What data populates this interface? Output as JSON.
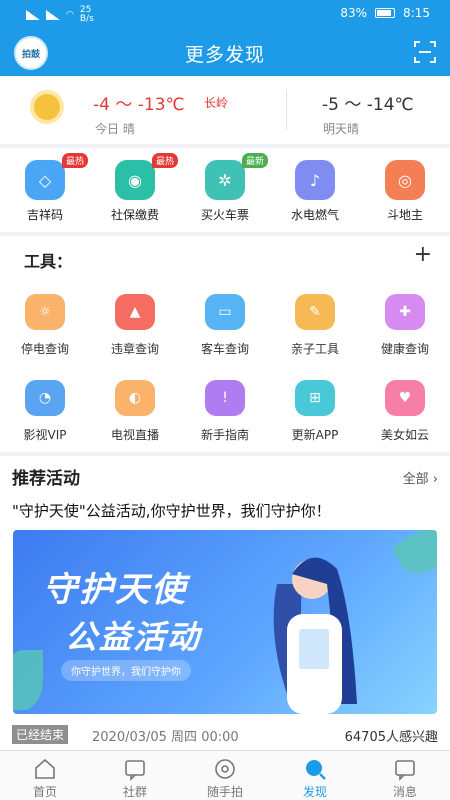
{
  "statusbar": {
    "network": "25\nB/s",
    "battery": "83%",
    "time": "8:15"
  },
  "header": {
    "title": "更多发现",
    "logo": "拍鼓"
  },
  "weather": {
    "today_temp": "-4 ～ -13℃",
    "city": "长岭",
    "today_label": "今日 晴",
    "tomorrow_temp": "-5 ～ -14℃",
    "tomorrow_label": "明天晴"
  },
  "quick_items": [
    {
      "label": "吉祥码",
      "badge": "最热",
      "color": "#4aa6f5"
    },
    {
      "label": "社保缴费",
      "badge": "最热",
      "color": "#2bbfa7"
    },
    {
      "label": "买火车票",
      "badge": "最新",
      "color": "#3fc1b5"
    },
    {
      "label": "水电燃气",
      "badge": "",
      "color": "#7f8cf2"
    },
    {
      "label": "斗地主",
      "badge": "",
      "color": "#f57f54"
    }
  ],
  "tools": {
    "title": "工具：",
    "items": [
      {
        "label": "停电查询",
        "color": "#fbb26a"
      },
      {
        "label": "违章查询",
        "color": "#f56c62"
      },
      {
        "label": "客车查询",
        "color": "#56b3f4"
      },
      {
        "label": "亲子工具",
        "color": "#f7b955"
      },
      {
        "label": "健康查询",
        "color": "#d78bf0"
      },
      {
        "label": "影视VIP",
        "color": "#5aa4f2"
      },
      {
        "label": "电视直播",
        "color": "#fbb26a"
      },
      {
        "label": "新手指南",
        "color": "#b07cf2"
      },
      {
        "label": "更新APP",
        "color": "#49c9d7"
      },
      {
        "label": "美女如云",
        "color": "#f77fa5"
      }
    ]
  },
  "promo": {
    "title": "推荐活动",
    "all": "全部 ›",
    "headline": "\"守护天使\"公益活动,你守护世界，我们守护你！",
    "banner_line1": "守护天使",
    "banner_line2": "公益活动",
    "banner_pill": "你守护世界，我们守护你",
    "status": "已经结束",
    "date": "2020/03/05 周四 00:00",
    "interest": "64705人感兴趣"
  },
  "tabs": [
    {
      "label": "首页",
      "active": false
    },
    {
      "label": "社群",
      "active": false
    },
    {
      "label": "随手拍",
      "active": false
    },
    {
      "label": "发现",
      "active": true
    },
    {
      "label": "消息",
      "active": false
    }
  ]
}
